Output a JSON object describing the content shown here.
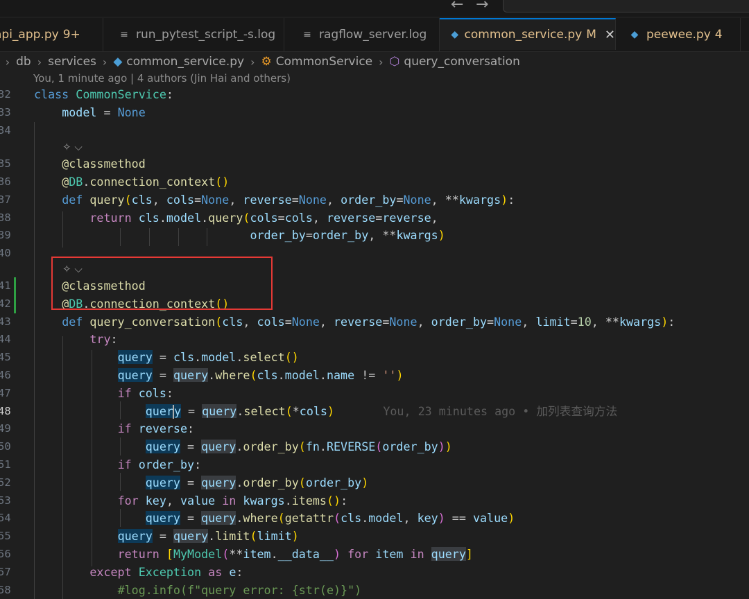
{
  "tabs": [
    {
      "label": "api_app.py",
      "badge": "9+"
    },
    {
      "label": "run_pytest_script_-s.log",
      "badge": ""
    },
    {
      "label": "ragflow_server.log",
      "badge": ""
    },
    {
      "label": "common_service.py",
      "badge": "M",
      "close": "✕"
    },
    {
      "label": "peewee.py",
      "badge": "4"
    }
  ],
  "breadcrumb": {
    "items": [
      "db",
      "services",
      "common_service.py",
      "CommonService",
      "query_conversation"
    ]
  },
  "codelens": {
    "blame": "You, 1 minute ago | 4 authors (Jin Hai and others)"
  },
  "line_numbers": [
    "32",
    "33",
    "34",
    "35",
    "36",
    "37",
    "38",
    "39",
    "40",
    "41",
    "42",
    "43",
    "44",
    "45",
    "46",
    "47",
    "48",
    "49",
    "50",
    "51",
    "52",
    "53",
    "54",
    "55",
    "56",
    "57",
    "58"
  ],
  "inline_blame": "You, 23 minutes ago • 加列表查询方法",
  "colors": {
    "accent": "#0078d4",
    "highlight_box": "#e53935",
    "added": "#2ea043"
  }
}
